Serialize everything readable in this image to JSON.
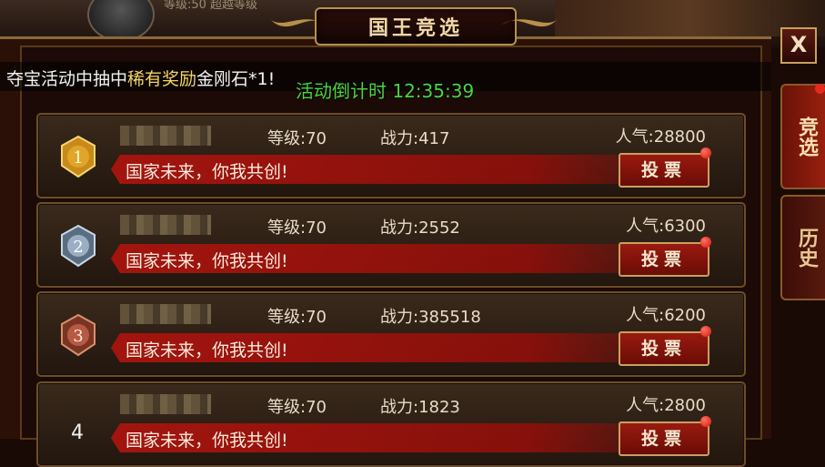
{
  "window": {
    "title": "国王竞选",
    "close_label": "X"
  },
  "top_hud": {
    "text": "等级:50  超越等级"
  },
  "notice": {
    "prefix": "夺宝活动中抽中",
    "highlight": "稀有奖励",
    "suffix": "金刚石*1!"
  },
  "countdown": "活动倒计时 12:35:39",
  "side_tabs": [
    {
      "label": "竞选",
      "active": true
    },
    {
      "label": "历史",
      "active": false
    }
  ],
  "candidates": [
    {
      "rank": "1",
      "level": "等级:70",
      "power": "战力:417",
      "popularity": "人气:28800",
      "slogan": "国家未来，你我共创!",
      "vote_label": "投票",
      "badge": "gold"
    },
    {
      "rank": "2",
      "level": "等级:70",
      "power": "战力:2552",
      "popularity": "人气:6300",
      "slogan": "国家未来，你我共创!",
      "vote_label": "投票",
      "badge": "silver"
    },
    {
      "rank": "3",
      "level": "等级:70",
      "power": "战力:385518",
      "popularity": "人气:6200",
      "slogan": "国家未来，你我共创!",
      "vote_label": "投票",
      "badge": "bronze"
    },
    {
      "rank": "4",
      "level": "等级:70",
      "power": "战力:1823",
      "popularity": "人气:2800",
      "slogan": "国家未来，你我共创!",
      "vote_label": "投票",
      "badge": "none"
    }
  ],
  "colors": {
    "gold": "#e0a62a",
    "silver": "#9aaec4",
    "bronze": "#b65a44",
    "countdown": "#49d43f",
    "highlight": "#f2d468"
  }
}
